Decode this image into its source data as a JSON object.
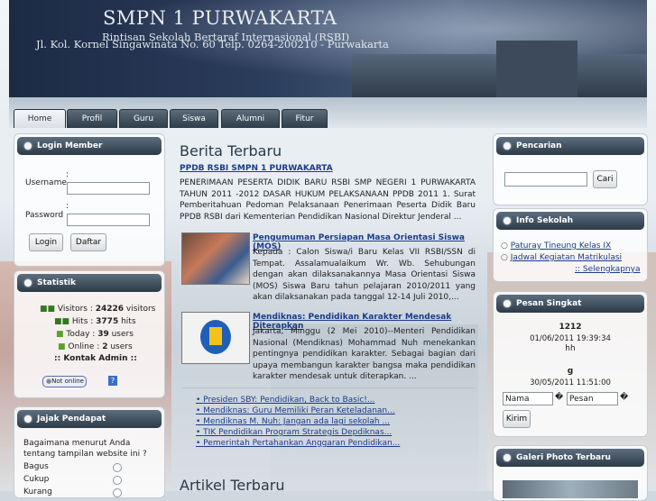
{
  "header": {
    "title": "SMPN 1 PURWAKARTA",
    "subtitle": "Rintisan Sekolah Bertaraf Internasional (RSBI)",
    "address": "Jl. Kol. Kornel Singawinata No. 60 Telp. 0264-200210 - Purwakarta"
  },
  "nav": {
    "tabs": [
      {
        "label": "Home"
      },
      {
        "label": "Profil"
      },
      {
        "label": "Guru"
      },
      {
        "label": "Siswa"
      },
      {
        "label": "Alumni"
      },
      {
        "label": "Fitur"
      }
    ]
  },
  "login": {
    "title": "Login Member",
    "username_label": "Username",
    "password_label": "Password",
    "colon": ":",
    "login_button": "Login",
    "register_button": "Daftar"
  },
  "stats": {
    "title": "Statistik",
    "visitors_label": "Visitors :",
    "visitors_value": "24226",
    "visitors_unit": "visitors",
    "hits_label": "Hits :",
    "hits_value": "3775",
    "hits_unit": "hits",
    "today_label": "Today :",
    "today_value": "39",
    "today_unit": "users",
    "online_label": "Online :",
    "online_value": "2",
    "online_unit": "users",
    "contact": ":: Kontak Admin ::",
    "status_badge": "Not online",
    "help_icon": "?"
  },
  "poll": {
    "title": "Jajak Pendapat",
    "question": "Bagaimana menurut Anda tentang tampilan website ini ?",
    "options": [
      "Bagus",
      "Cukup",
      "Kurang"
    ]
  },
  "main": {
    "news_heading": "Berita Terbaru",
    "headline_title": "PPDB RSBI SMPN 1 PURWAKARTA",
    "headline_text": "PENERIMAAN PESERTA DIDIK BARU RSBI SMP NEGERI 1 PURWAKARTA TAHUN 2011 -2012    DASAR HUKUM PELAKSANAAN PPDB 2011 1.       Surat Pemberitahuan Pedoman Pelaksanaan Penerimaan Peserta Didik Baru PPDB RSBI dari Kementerian Pendidikan Nasional Direktur Jenderal ...",
    "article1_title": "Pengumuman Persiapan Masa Orientasi Siswa (MOS)",
    "article1_text": "Kepada : Calon Siswa/i Baru Kelas VII RSBI/SSN di Tempat. Assalamualaikum Wr. Wb. Sehubungan dengan akan dilaksanakannya Masa Orientasi Siswa (MOS) Siswa Baru tahun pelajaran 2010/2011 yang akan dilaksanakan pada tanggal 12-14 Juli 2010,...",
    "article2_title": "Mendiknas: Pendidikan Karakter Mendesak Diterapkan",
    "article2_text": "Jakarta, Minggu (2 Mei 2010)--Menteri Pendidikan Nasional (Mendiknas) Mohammad Nuh menekankan pentingnya pendidikan karakter. Sebagai bagian dari upaya membangun karakter bangsa maka pendidikan karakter mendesak untuk diterapkan. ...",
    "more_links": [
      " Presiden SBY: Pendidikan, Back to Basic!...",
      " Mendiknas: Guru Memiliki Peran Keteladanan...",
      " Mendiknas M. Nuh: Jangan ada lagi sekolah ...",
      " TIK Pendidikan Program Strategis Depdiknas...",
      " Pemerintah Pertahankan Anggaran Pendidikan..."
    ],
    "articles_heading": "Artikel Terbaru"
  },
  "search": {
    "title": "Pencarian",
    "input_value": "",
    "button": "Cari"
  },
  "info": {
    "title": "Info Sekolah",
    "items": [
      "Paturay Tineung Kelas IX",
      "Jadwal Kegiatan Matrikulasi"
    ],
    "more": ":: Selengkapnya"
  },
  "shout": {
    "title": "Pesan Singkat",
    "messages": [
      {
        "name": "1212",
        "time": "01/06/2011 19:39:34",
        "text": "hh"
      },
      {
        "name": "g",
        "time": "30/05/2011 11:51:00",
        "text": ""
      }
    ],
    "name_value": "Nama",
    "message_value": "Pesan",
    "sep_glyph": "�",
    "button": "Kirim"
  },
  "gallery": {
    "title": "Galeri Photo Terbaru"
  },
  "colors": {
    "header_bg": "#2b3d5c",
    "box_head": "#3c4b59",
    "link": "#1a3d8a"
  }
}
